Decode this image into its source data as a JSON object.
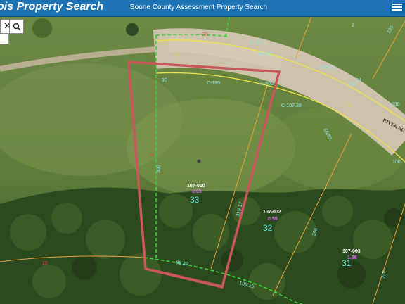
{
  "header": {
    "app_title": "ois Property Search",
    "county_title": "Boone County Assessment Property Search"
  },
  "search": {
    "placeholder": ""
  },
  "toolbar": {
    "clear_label": "✕",
    "search_icon": "search-icon"
  },
  "map": {
    "road_name": "RIVER RU",
    "labels": {
      "c112": "C-112",
      "r560": "R-560",
      "c6071": "C-60.71",
      "c180": "C-180",
      "r500": "R-500",
      "c10738": "C-107.38",
      "d3": "30",
      "d300": "300",
      "d31917": "319.17",
      "d8829": "88.29",
      "d10815": "108.15",
      "d6589": "65.89",
      "d130": "130",
      "d100": "100",
      "d135": "135",
      "d266": "266",
      "d230": "230",
      "d24": "24",
      "d28": "28",
      "d2": "2",
      "d8a": "8",
      "d8b": "8",
      "d20": "20",
      "d16": "16",
      "d11": "11",
      "num33": "33",
      "num32": "32",
      "num31": "31",
      "p1": "107-000",
      "p1acre": "0.65",
      "p2": "107-002",
      "p2acre": "0.59",
      "p3": "107-003",
      "p3acre": "1.56"
    },
    "colors": {
      "subject_parcel": "#c9575b",
      "lot_lines": "#e8a23a",
      "right_of_way": "#f4e04a",
      "easement": "#39d23a",
      "road": "#cdc3ad"
    }
  }
}
